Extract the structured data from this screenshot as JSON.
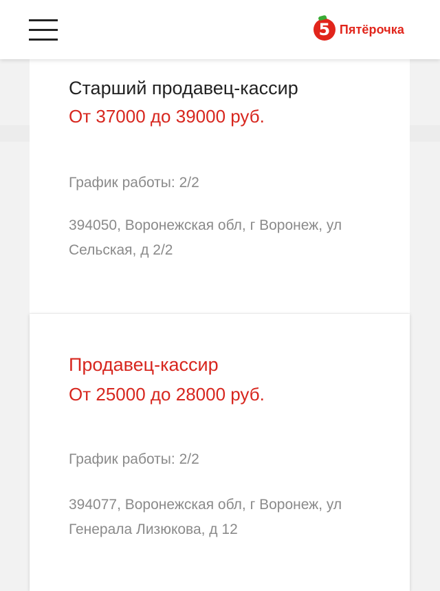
{
  "header": {
    "menu_icon": "hamburger-menu-icon",
    "logo": {
      "mark_text": "5",
      "name": "Пятёрочка",
      "brand_color": "#e1251b",
      "leaf_color": "#3aaa35"
    }
  },
  "vacancies": [
    {
      "title": "Старший продавец-кассир",
      "salary": "От 37000 до 39000 руб.",
      "schedule": "График работы: 2/2",
      "address": "394050, Воронежская обл, г Воронеж, ул Сельская, д 2/2"
    },
    {
      "title": "Продавец-кассир",
      "salary": "От 25000 до 28000 руб.",
      "schedule": "График работы: 2/2",
      "address": "394077, Воронежская обл, г Воронеж, ул Генерала Лизюкова, д 12"
    }
  ],
  "colors": {
    "accent": "#d7261e",
    "muted_text": "#8a8a8a",
    "page_bg": "#f2f2f2"
  }
}
